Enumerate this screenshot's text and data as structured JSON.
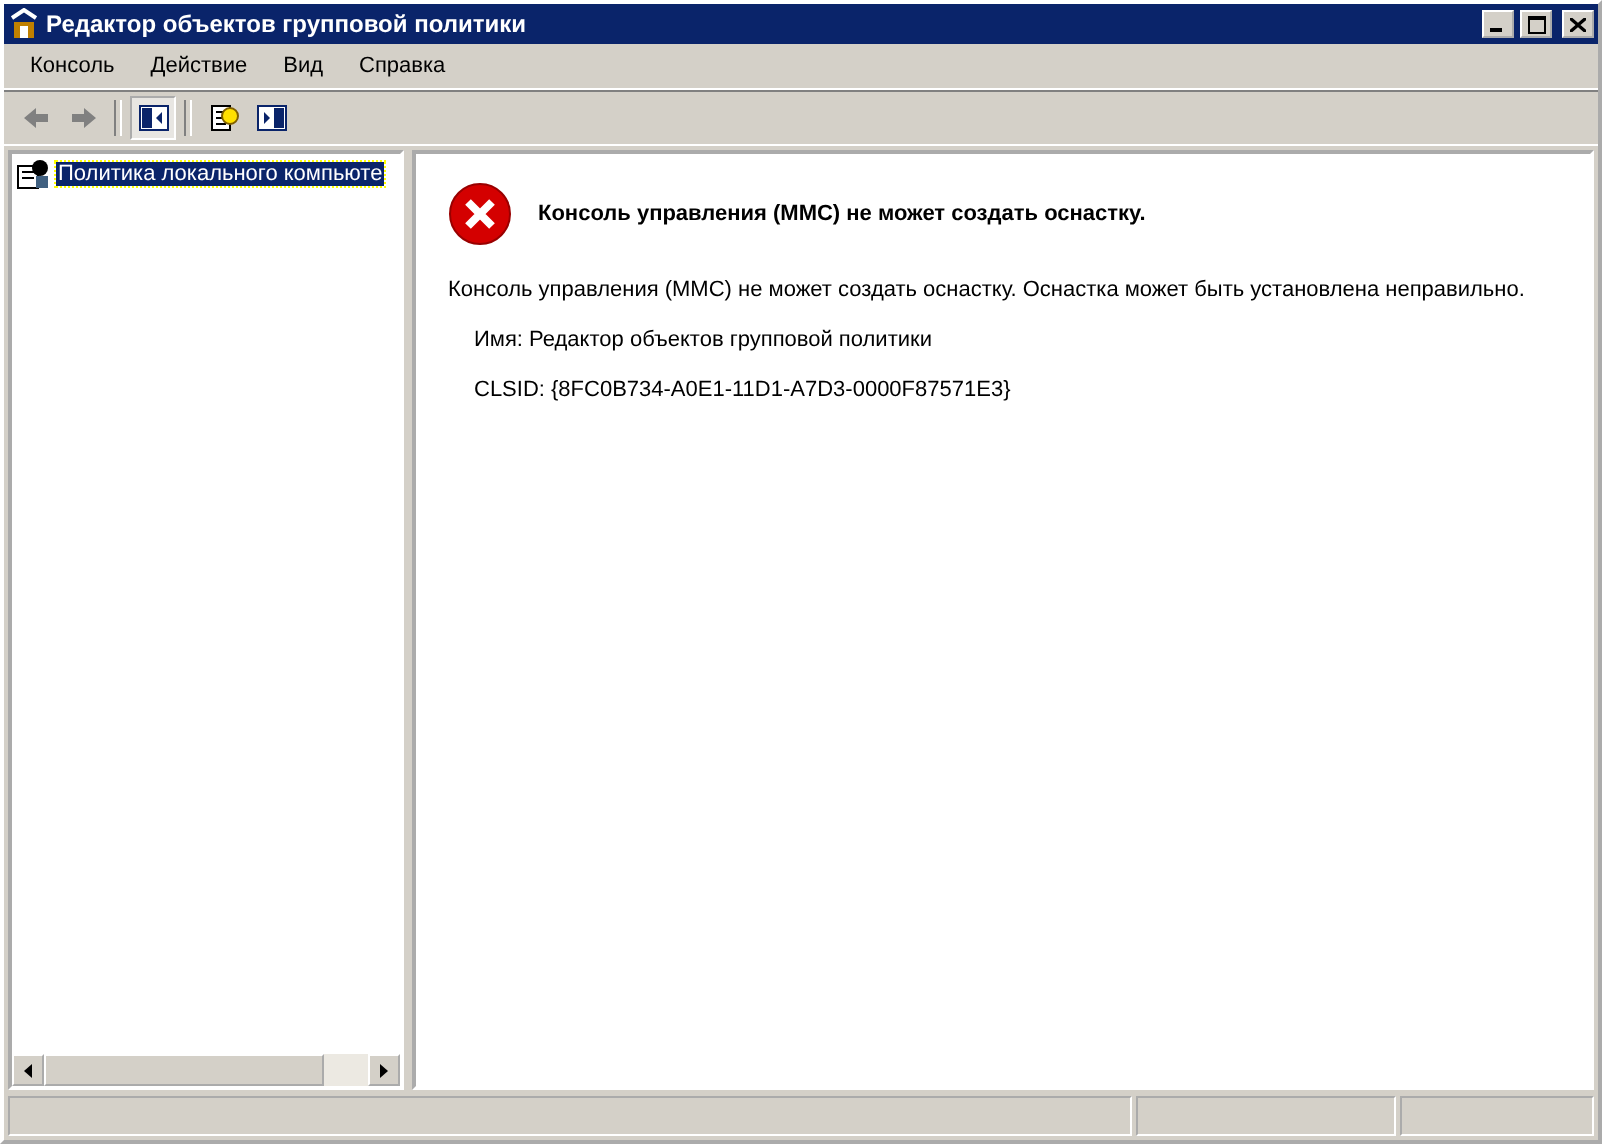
{
  "window": {
    "title": "Редактор объектов групповой политики"
  },
  "menu": [
    {
      "label": "Консоль"
    },
    {
      "label": "Действие"
    },
    {
      "label": "Вид"
    },
    {
      "label": "Справка"
    }
  ],
  "toolbar": [
    {
      "kind": "back",
      "disabled": true,
      "pressed": false
    },
    {
      "kind": "forward",
      "disabled": true,
      "pressed": false
    },
    {
      "kind": "separator"
    },
    {
      "kind": "tree",
      "disabled": false,
      "pressed": true
    },
    {
      "kind": "separator"
    },
    {
      "kind": "help",
      "disabled": false,
      "pressed": false
    },
    {
      "kind": "panel",
      "disabled": false,
      "pressed": false
    }
  ],
  "tree": {
    "items": [
      {
        "label": "Политика локального компьюте",
        "selected": true
      }
    ]
  },
  "message": {
    "heading": "Консоль управления (MMC) не может создать оснастку.",
    "body": "Консоль управления (MMC) не может создать оснастку. Оснастка может быть установлена неправильно.",
    "details": [
      "Имя: Редактор объектов групповой политики",
      "CLSID: {8FC0B734-A0E1-11D1-A7D3-0000F87571E3}"
    ]
  }
}
